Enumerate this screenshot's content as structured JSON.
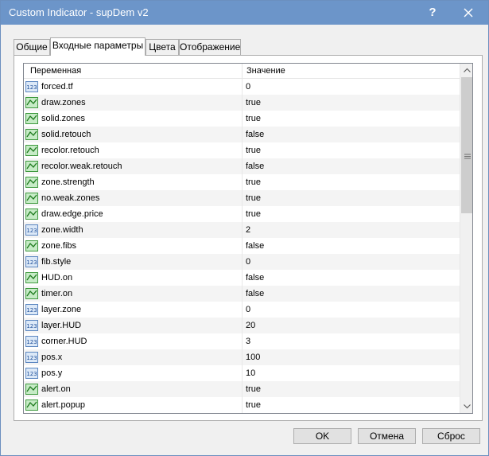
{
  "window": {
    "title": "Custom Indicator - supDem v2",
    "help_label": "?",
    "titlebar_color": "#6c95c9"
  },
  "tabs": [
    {
      "label": "Общие",
      "active": false
    },
    {
      "label": "Входные параметры",
      "active": true
    },
    {
      "label": "Цвета",
      "active": false
    },
    {
      "label": "Отображение",
      "active": false
    }
  ],
  "table": {
    "columns": [
      "Переменная",
      "Значение"
    ],
    "rows": [
      {
        "icon": "numeric-icon",
        "name": "forced.tf",
        "value": "0"
      },
      {
        "icon": "bool-icon",
        "name": "draw.zones",
        "value": "true"
      },
      {
        "icon": "bool-icon",
        "name": "solid.zones",
        "value": "true"
      },
      {
        "icon": "bool-icon",
        "name": "solid.retouch",
        "value": "false"
      },
      {
        "icon": "bool-icon",
        "name": "recolor.retouch",
        "value": "true"
      },
      {
        "icon": "bool-icon",
        "name": "recolor.weak.retouch",
        "value": "false"
      },
      {
        "icon": "bool-icon",
        "name": "zone.strength",
        "value": "true"
      },
      {
        "icon": "bool-icon",
        "name": "no.weak.zones",
        "value": "true"
      },
      {
        "icon": "bool-icon",
        "name": "draw.edge.price",
        "value": "true"
      },
      {
        "icon": "numeric-icon",
        "name": "zone.width",
        "value": "2"
      },
      {
        "icon": "bool-icon",
        "name": "zone.fibs",
        "value": "false"
      },
      {
        "icon": "numeric-icon",
        "name": "fib.style",
        "value": "0"
      },
      {
        "icon": "bool-icon",
        "name": "HUD.on",
        "value": "false"
      },
      {
        "icon": "bool-icon",
        "name": "timer.on",
        "value": "false"
      },
      {
        "icon": "numeric-icon",
        "name": "layer.zone",
        "value": "0"
      },
      {
        "icon": "numeric-icon",
        "name": "layer.HUD",
        "value": "20"
      },
      {
        "icon": "numeric-icon",
        "name": "corner.HUD",
        "value": "3"
      },
      {
        "icon": "numeric-icon",
        "name": "pos.x",
        "value": "100"
      },
      {
        "icon": "numeric-icon",
        "name": "pos.y",
        "value": "10"
      },
      {
        "icon": "bool-icon",
        "name": "alert.on",
        "value": "true"
      },
      {
        "icon": "bool-icon",
        "name": "alert.popup",
        "value": "true"
      }
    ]
  },
  "buttons": {
    "ok": "OK",
    "cancel": "Отмена",
    "reset": "Сброс"
  }
}
